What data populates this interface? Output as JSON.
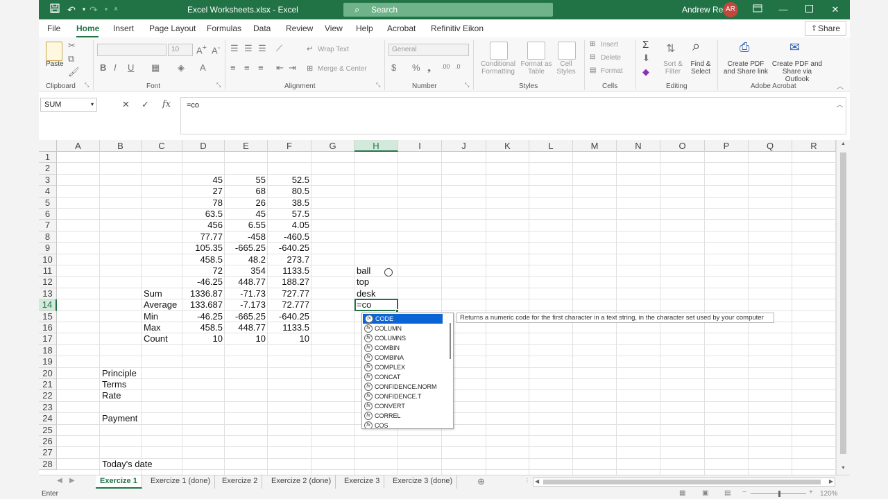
{
  "window": {
    "title": "Excel Worksheets.xlsx  -  Excel",
    "search_placeholder": "Search",
    "user_name": "Andrew Reil",
    "user_initials": "AR"
  },
  "menu": {
    "items": [
      "File",
      "Home",
      "Insert",
      "Page Layout",
      "Formulas",
      "Data",
      "Review",
      "View",
      "Help",
      "Acrobat",
      "Refinitiv Eikon"
    ],
    "active": "Home",
    "share_label": "Share"
  },
  "ribbon": {
    "clipboard": {
      "label": "Clipboard",
      "paste": "Paste"
    },
    "font": {
      "label": "Font",
      "font_size": "10"
    },
    "alignment": {
      "label": "Alignment",
      "wrap_text": "Wrap Text",
      "merge_center": "Merge & Center"
    },
    "number": {
      "label": "Number",
      "format": "General"
    },
    "styles": {
      "label": "Styles",
      "conditional": "Conditional Formatting",
      "format_table": "Format as Table",
      "cell_styles": "Cell Styles"
    },
    "cells": {
      "label": "Cells",
      "insert": "Insert",
      "delete": "Delete",
      "format": "Format"
    },
    "editing": {
      "label": "Editing",
      "sort_filter": "Sort & Filter",
      "find_select": "Find & Select"
    },
    "acrobat": {
      "label": "Adobe Acrobat",
      "create_share": "Create PDF and Share link",
      "create_outlook": "Create PDF and Share via Outlook"
    }
  },
  "formula_bar": {
    "name_box": "SUM",
    "formula": "=co"
  },
  "grid": {
    "columns": [
      "A",
      "B",
      "C",
      "D",
      "E",
      "F",
      "G",
      "H",
      "I",
      "J",
      "K",
      "L",
      "M",
      "N",
      "O",
      "P",
      "Q",
      "R"
    ],
    "rows": [
      "1",
      "2",
      "3",
      "4",
      "5",
      "6",
      "7",
      "8",
      "9",
      "10",
      "11",
      "12",
      "13",
      "14",
      "15",
      "16",
      "17",
      "18",
      "19",
      "20",
      "21",
      "22",
      "23",
      "24",
      "25",
      "26",
      "27",
      "28"
    ],
    "selected_column": "H",
    "selected_row": "14",
    "cells": {
      "D3": "45",
      "E3": "55",
      "F3": "52.5",
      "D4": "27",
      "E4": "68",
      "F4": "80.5",
      "D5": "78",
      "E5": "26",
      "F5": "38.5",
      "D6": "63.5",
      "E6": "45",
      "F6": "57.5",
      "D7": "456",
      "E7": "6.55",
      "F7": "4.05",
      "D8": "77.77",
      "E8": "-458",
      "F8": "-460.5",
      "D9": "105.35",
      "E9": "-665.25",
      "F9": "-640.25",
      "D10": "458.5",
      "E10": "48.2",
      "F10": "273.7",
      "D11": "72",
      "E11": "354",
      "F11": "1133.5",
      "D12": "-46.25",
      "E12": "448.77",
      "F12": "188.27",
      "C13": "Sum",
      "D13": "1336.87",
      "E13": "-71.73",
      "F13": "727.77",
      "C14": "Average",
      "D14": "133.687",
      "E14": "-7.173",
      "F14": "72.777",
      "C15": "Min",
      "D15": "-46.25",
      "E15": "-665.25",
      "F15": "-640.25",
      "C16": "Max",
      "D16": "458.5",
      "E16": "448.77",
      "F16": "1133.5",
      "C17": "Count",
      "D17": "10",
      "E17": "10",
      "F17": "10",
      "H11": "ball",
      "H12": "top",
      "H13": "desk",
      "B20": "Principle",
      "B21": "Terms",
      "B22": "Rate",
      "B24": "Payment",
      "B28": "Today's date"
    },
    "active_cell_value": "=co"
  },
  "autocomplete": {
    "items": [
      "CODE",
      "COLUMN",
      "COLUMNS",
      "COMBIN",
      "COMBINA",
      "COMPLEX",
      "CONCAT",
      "CONFIDENCE.NORM",
      "CONFIDENCE.T",
      "CONVERT",
      "CORREL",
      "COS"
    ],
    "selected": "CODE",
    "tooltip": "Returns a numeric code for the first character in a text string, in the character set used by your computer"
  },
  "sheets": {
    "tabs": [
      "Exercize 1",
      "Exercize 1 (done)",
      "Exercize 2",
      "Exercize 2 (done)",
      "Exercize 3",
      "Exercize 3 (done)"
    ],
    "active": "Exercize 1"
  },
  "status": {
    "mode": "Enter",
    "zoom": "120%"
  },
  "colors": {
    "brand": "#217346",
    "selection": "#0a64d6"
  }
}
